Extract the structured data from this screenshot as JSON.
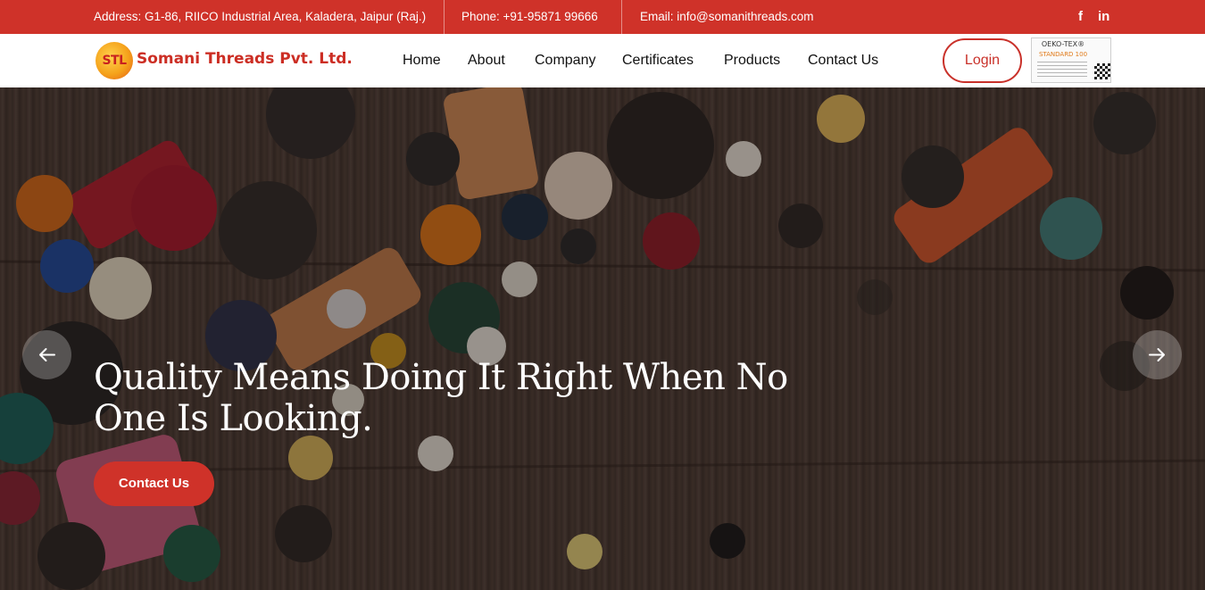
{
  "topbar": {
    "address": "Address: G1-86, RIICO Industrial Area, Kaladera, Jaipur (Raj.)",
    "phone": "Phone: +91-95871 99666",
    "email": "Email: info@somanithreads.com",
    "social": [
      {
        "icon": "facebook-icon",
        "glyph": "f"
      },
      {
        "icon": "linkedin-icon",
        "glyph": "in"
      }
    ],
    "bg_color": "#cf3229"
  },
  "brand": {
    "logo_initials": "STL",
    "name": "Somani Threads Pvt. Ltd."
  },
  "nav": {
    "items": [
      {
        "label": "Home"
      },
      {
        "label": "About"
      },
      {
        "label": "Company"
      },
      {
        "label": "Certificates"
      },
      {
        "label": "Products"
      },
      {
        "label": "Contact Us"
      }
    ],
    "login_label": "Login"
  },
  "certificate": {
    "title": "OEKO-TEX®",
    "subtitle": "STANDARD 100"
  },
  "hero": {
    "title": "Quality Means Doing It Right When No One Is Looking.",
    "cta_label": "Contact Us",
    "prev_icon": "arrow-left-icon",
    "next_icon": "arrow-right-icon"
  },
  "colors": {
    "accent": "#cf3229",
    "text_dark": "#111111"
  }
}
